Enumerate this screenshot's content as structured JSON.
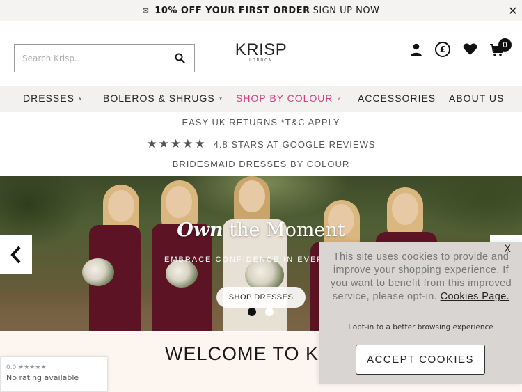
{
  "promo": {
    "icon": "mail-icon",
    "bold_text": "10% OFF YOUR FIRST ORDER",
    "rest_text": "SIGN UP NOW",
    "close_label": "✕"
  },
  "header": {
    "search_placeholder": "Search Krisp...",
    "logo_text": "KRISP",
    "logo_sub": "LONDON",
    "currency_symbol": "£",
    "cart_count": "0",
    "icons": [
      "account-icon",
      "currency-icon",
      "wishlist-heart-icon",
      "cart-icon",
      "search-icon"
    ]
  },
  "nav": {
    "items": [
      {
        "label": "DRESSES",
        "has_dropdown": true
      },
      {
        "label": "BOLEROS & SHRUGS",
        "has_dropdown": true
      },
      {
        "label": "SHOP BY COLOUR",
        "has_dropdown": true,
        "highlight_color": "#d1407a"
      },
      {
        "label": "ACCESSORIES",
        "has_dropdown": false
      },
      {
        "label": "ABOUT US",
        "has_dropdown": false
      }
    ],
    "caret": "˅"
  },
  "usp": {
    "returns": "EASY UK RETURNS *T&C APPLY",
    "stars": "★★★★★",
    "reviews": "4.8 STARS AT GOOGLE REVIEWS",
    "bridesmaid": "BRIDESMAID DRESSES BY COLOUR"
  },
  "hero": {
    "title_em": "Own",
    "title_rest": " the Moment",
    "subtitle": "EMBRACE CONFIDENCE IN EVERY OC",
    "button": "SHOP DRESSES",
    "slides": 2,
    "active_slide": 1
  },
  "welcome": {
    "heading": "WELCOME TO KR"
  },
  "rating_widget": {
    "top": "0.0 ★★★★★",
    "bottom": "No rating available"
  },
  "cookie": {
    "close_label": "X",
    "message": "This site uses cookies to provide and improve your shopping experience. If you want to benefit from this improved service, please opt-in.",
    "link": "Cookies Page.",
    "optin": "I opt-in to a better browsing experience",
    "accept": "ACCEPT COOKIES"
  },
  "colors": {
    "promo_bg": "#f5f3f1",
    "nav_bg": "#f2f1f0",
    "accent_pink": "#d1407a",
    "dress_burgundy": "#5c1424",
    "welcome_bg": "#fdf5f0",
    "cookie_bg": "#d8d5d2"
  }
}
